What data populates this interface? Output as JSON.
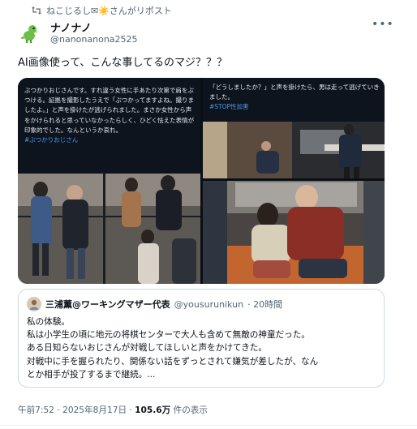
{
  "repost": {
    "icon": "repost-icon",
    "text": "ねこじるし✉☀️さんがリポスト"
  },
  "author": {
    "name": "ナノナノ",
    "handle": "@nanonanona2525",
    "avatar_icon": "green-dinosaur-icon"
  },
  "more_icon": "more-options-icon",
  "tweet_text": "AI画像使って、こんな事してるのマジ？？？",
  "media": {
    "top_left": {
      "caption": "ぶつかりおじさんです。すれ違う女性に手あたり次第で肩をぶつける。証拠を撮影したうえで「ぶつかってますよね。撮りましたよ。」と声を掛けたが逃げられました。まさか女性から声をかけられると思っていなかったらしく、ひどく怯えた表情が印象的でした。なんというか哀れ。",
      "hashtag": "#ぶつかりおじさん"
    },
    "top_right": {
      "caption": "「どうしましたか？」と声を掛けたら、男は走って逃げていきました。",
      "hashtag": "#STOP性加害"
    }
  },
  "quote": {
    "name": "三浦薫@ワーキングマザー代表",
    "handle": "@yousurunikun",
    "time": "· 20時間",
    "lines": [
      "私の体験。",
      "私は小学生の頃に地元の将棋センターで大人も含めて無敵の神童だった。",
      "ある日知らないおじさんが対戦してほしいと声をかけてきた。",
      "対戦中に手を握られたり、関係ない話をずっとされて嫌気が差したが、なん",
      "とか相手が投了するまで継続。..."
    ]
  },
  "meta": {
    "time": "午前7:52 · 2025年8月17日 · ",
    "views": "105.6万",
    "views_suffix": " 件の表示"
  },
  "colors": {
    "link": "#1d9bf0",
    "hashtag_in_image": "#4a99e9",
    "secondary_text": "#536471"
  }
}
